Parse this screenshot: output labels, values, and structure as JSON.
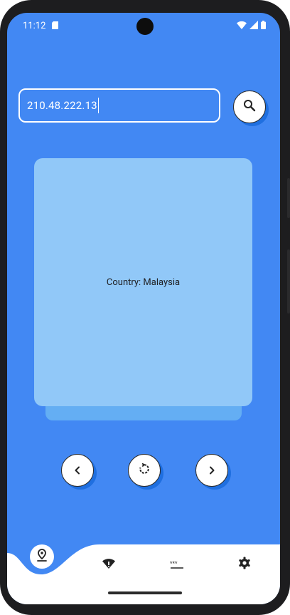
{
  "status_bar": {
    "time": "11:12",
    "icons": [
      "sd-card-icon",
      "wifi-icon",
      "signal-icon",
      "battery-icon"
    ]
  },
  "search": {
    "value": "210.48.222.13",
    "icon": "search-icon"
  },
  "card": {
    "text": "Country: Malaysia"
  },
  "controls": {
    "previous_icon": "chevron-left-icon",
    "refresh_icon": "refresh-icon",
    "next_icon": "chevron-right-icon"
  },
  "bottom_nav": {
    "items": [
      {
        "icon": "location-pin-icon",
        "active": true
      },
      {
        "icon": "wifi-info-icon",
        "active": false
      },
      {
        "icon": "password-icon",
        "active": false
      },
      {
        "icon": "gear-icon",
        "active": false
      }
    ]
  },
  "colors": {
    "background": "#4288f3",
    "card": "#91c8f8",
    "card_shadow": "#64aef3",
    "button_shadow": "#1f6fe0",
    "surface": "#ffffff"
  }
}
